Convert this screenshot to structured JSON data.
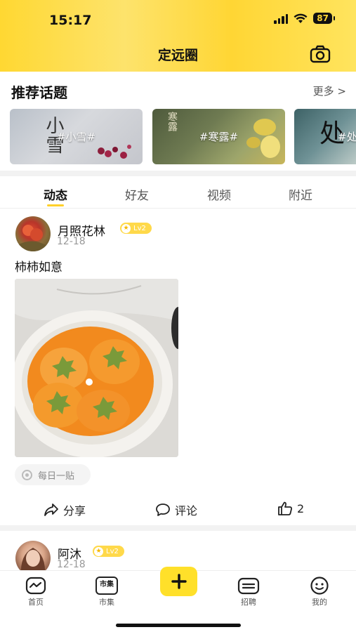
{
  "status_bar": {
    "time": "15:17",
    "battery": "87"
  },
  "header": {
    "title": "定远圈"
  },
  "topics": {
    "title": "推荐话题",
    "more": "更多 >",
    "cards": [
      {
        "tag": "#小雪#",
        "art_text": "小雪"
      },
      {
        "tag": "#寒露#",
        "art_text": "寒露"
      },
      {
        "tag": "#处",
        "art_text": "处"
      }
    ]
  },
  "tabs": [
    {
      "label": "动态",
      "active": true
    },
    {
      "label": "好友",
      "active": false
    },
    {
      "label": "视频",
      "active": false
    },
    {
      "label": "附近",
      "active": false
    }
  ],
  "posts": [
    {
      "username": "月照花林",
      "level": "Lv2",
      "date": "12-18",
      "text": "柿柿如意",
      "topic_chip": "每日一贴",
      "actions": {
        "share": "分享",
        "comment": "评论",
        "likes": "2"
      }
    },
    {
      "username": "阿沐",
      "level": "Lv2",
      "date": "12-18"
    }
  ],
  "tabbar": {
    "items": [
      {
        "label": "首页",
        "icon": "home-icon"
      },
      {
        "label": "市集",
        "icon": "market-icon",
        "icon_text": "市集"
      },
      {
        "label": "",
        "icon": "plus-icon"
      },
      {
        "label": "招聘",
        "icon": "recruit-icon"
      },
      {
        "label": "我的",
        "icon": "profile-icon"
      }
    ]
  },
  "colors": {
    "brand_yellow": "#ffd634",
    "accent": "#ffe02a"
  }
}
